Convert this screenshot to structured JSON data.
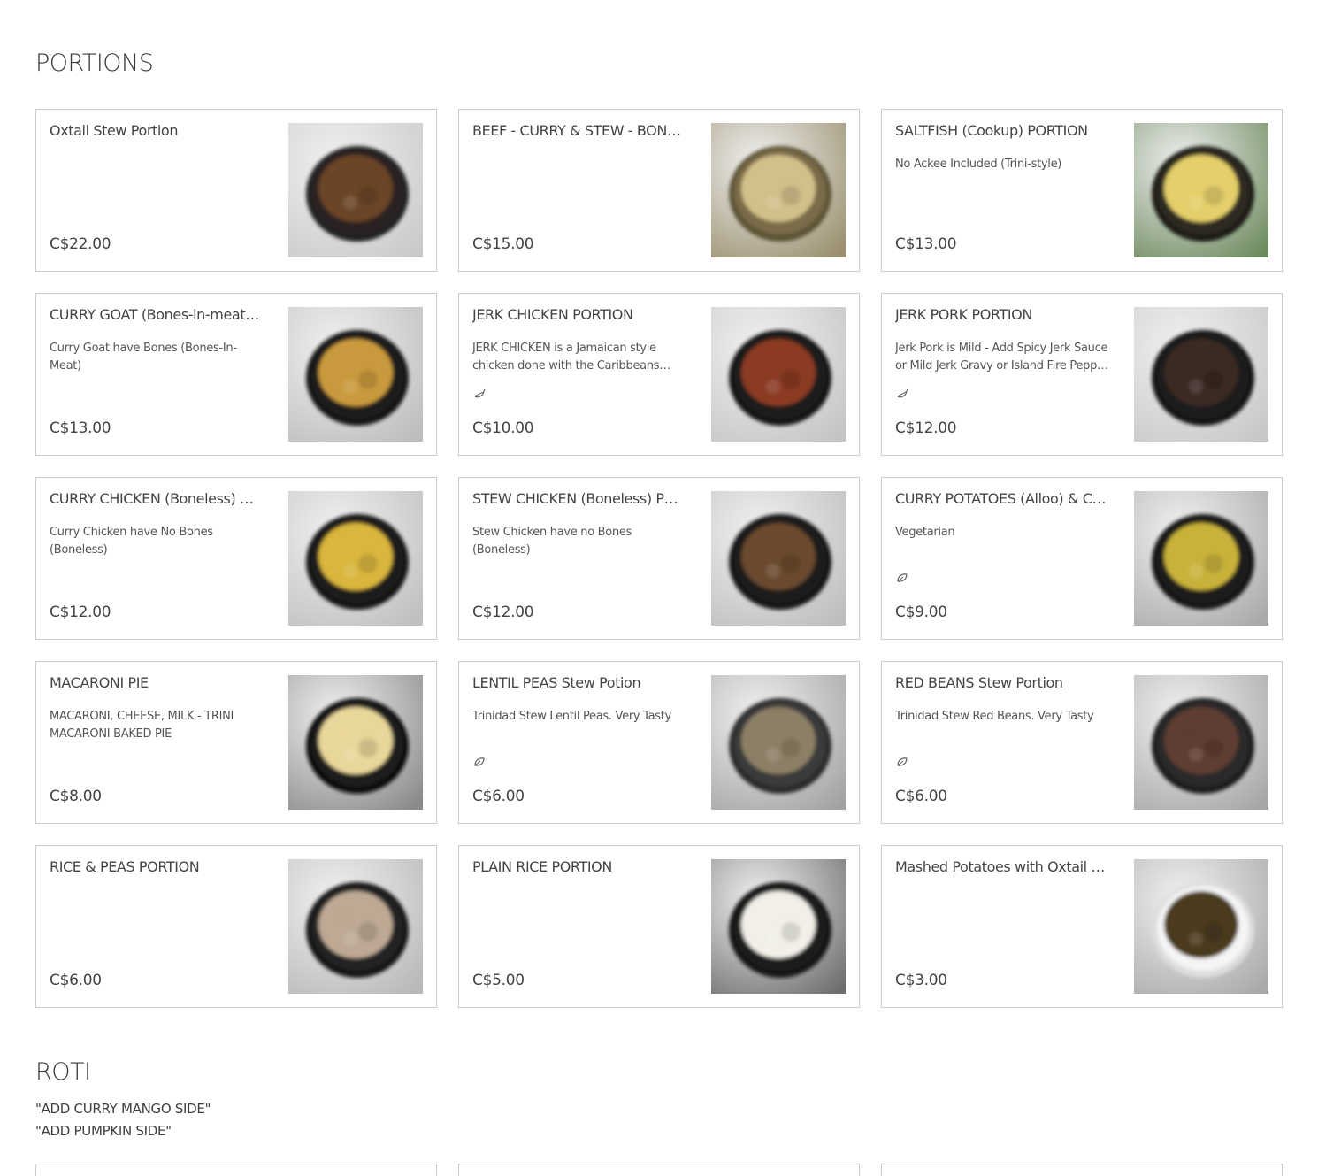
{
  "sections": {
    "portions_title": "PORTIONS",
    "roti_title": "ROTI",
    "roti_desc_line1": "\"ADD CURRY MANGO SIDE\"",
    "roti_desc_line2": "\"ADD PUMPKIN SIDE\""
  },
  "items": [
    {
      "name": "Oxtail Stew Portion",
      "desc": "",
      "price": "C$22.00",
      "icon": "",
      "bg": "#c9c9c9",
      "bowl": "#2b2420",
      "food": "#6b4526",
      "rim": "#222222"
    },
    {
      "name": "BEEF - CURRY & STEW - BONELESS",
      "desc": "",
      "price": "C$15.00",
      "icon": "",
      "bg": "#9a8f6e",
      "bowl": "#7a6c48",
      "food": "#d2c08a",
      "rim": "#5b5236"
    },
    {
      "name": "SALTFISH (Cookup) PORTION",
      "desc": "No Ackee Included (Trini-style)",
      "price": "C$13.00",
      "icon": "",
      "bg": "#6c8a5e",
      "bowl": "#2d2a20",
      "food": "#e4cf6a",
      "rim": "#1e1e18"
    },
    {
      "name": "CURRY GOAT (Bones-in-meat) PORTION",
      "desc": "Curry Goat have Bones (Bones-In-Meat)",
      "price": "C$13.00",
      "icon": "",
      "bg": "#bdbdbd",
      "bowl": "#1f1f1f",
      "food": "#c99a3c",
      "rim": "#161616"
    },
    {
      "name": "JERK CHICKEN PORTION",
      "desc": "JERK CHICKEN is a Jamaican style chicken done with the Caribbeans most authentic jerk seasoning",
      "price": "C$10.00",
      "icon": "pepper-icon",
      "bg": "#c4c4c4",
      "bowl": "#1b1b1b",
      "food": "#8a3a22",
      "rim": "#121212"
    },
    {
      "name": "JERK PORK PORTION",
      "desc": "Jerk Pork is Mild - Add Spicy Jerk Sauce or Mild Jerk Gravy or Island Fire Pepper Sauce",
      "price": "C$12.00",
      "icon": "pepper-icon",
      "bg": "#c7c7c7",
      "bowl": "#1b1b1b",
      "food": "#3a2a22",
      "rim": "#121212"
    },
    {
      "name": "CURRY CHICKEN (Boneless) PORTION",
      "desc": "Curry Chicken have No Bones (Boneless)",
      "price": "C$12.00",
      "icon": "",
      "bg": "#bfbfbf",
      "bowl": "#1f1f1f",
      "food": "#d9b63c",
      "rim": "#141414"
    },
    {
      "name": "STEW CHICKEN (Boneless) PORTION",
      "desc": "Stew Chicken have no Bones (Boneless)",
      "price": "C$12.00",
      "icon": "",
      "bg": "#bdbdbd",
      "bowl": "#1c1c1c",
      "food": "#6a4a2e",
      "rim": "#121212"
    },
    {
      "name": "CURRY POTATOES (Alloo) & CHICK PEAS",
      "desc": "Vegetarian",
      "price": "C$9.00",
      "icon": "leaf-icon",
      "bg": "#a9a9a9",
      "bowl": "#1f1f1f",
      "food": "#c9b23a",
      "rim": "#151515"
    },
    {
      "name": "MACARONI PIE",
      "desc": "MACARONI, CHEESE, MILK - TRINI MACARONI BAKED PIE",
      "price": "C$8.00",
      "icon": "",
      "bg": "#8a8a8a",
      "bowl": "#1a1a1a",
      "food": "#e8d79a",
      "rim": "#101010"
    },
    {
      "name": "LENTIL PEAS Stew Potion",
      "desc": "Trinidad Stew Lentil Peas.  Very Tasty",
      "price": "C$6.00",
      "icon": "leaf-icon",
      "bg": "#a2a2a2",
      "bowl": "#3a3a3a",
      "food": "#8c7f66",
      "rim": "#2a2a2a"
    },
    {
      "name": "RED BEANS Stew Portion",
      "desc": "Trinidad Stew Red Beans.  Very Tasty",
      "price": "C$6.00",
      "icon": "leaf-icon",
      "bg": "#a6a6a6",
      "bowl": "#2a2a2a",
      "food": "#5e3c30",
      "rim": "#1c1c1c"
    },
    {
      "name": "RICE & PEAS PORTION",
      "desc": "",
      "price": "C$6.00",
      "icon": "",
      "bg": "#b8b8b8",
      "bowl": "#242424",
      "food": "#bda994",
      "rim": "#161616"
    },
    {
      "name": "PLAIN RICE PORTION",
      "desc": "",
      "price": "C$5.00",
      "icon": "",
      "bg": "#6e6e6e",
      "bowl": "#1c1c1c",
      "food": "#f1efe8",
      "rim": "#121212"
    },
    {
      "name": "Mashed Potatoes with Oxtail Stew Gravy",
      "desc": "",
      "price": "C$3.00",
      "icon": "",
      "bg": "#a9a9a9",
      "bowl": "#f5f5f5",
      "food": "#4a3a1e",
      "rim": "#dddddd"
    }
  ]
}
